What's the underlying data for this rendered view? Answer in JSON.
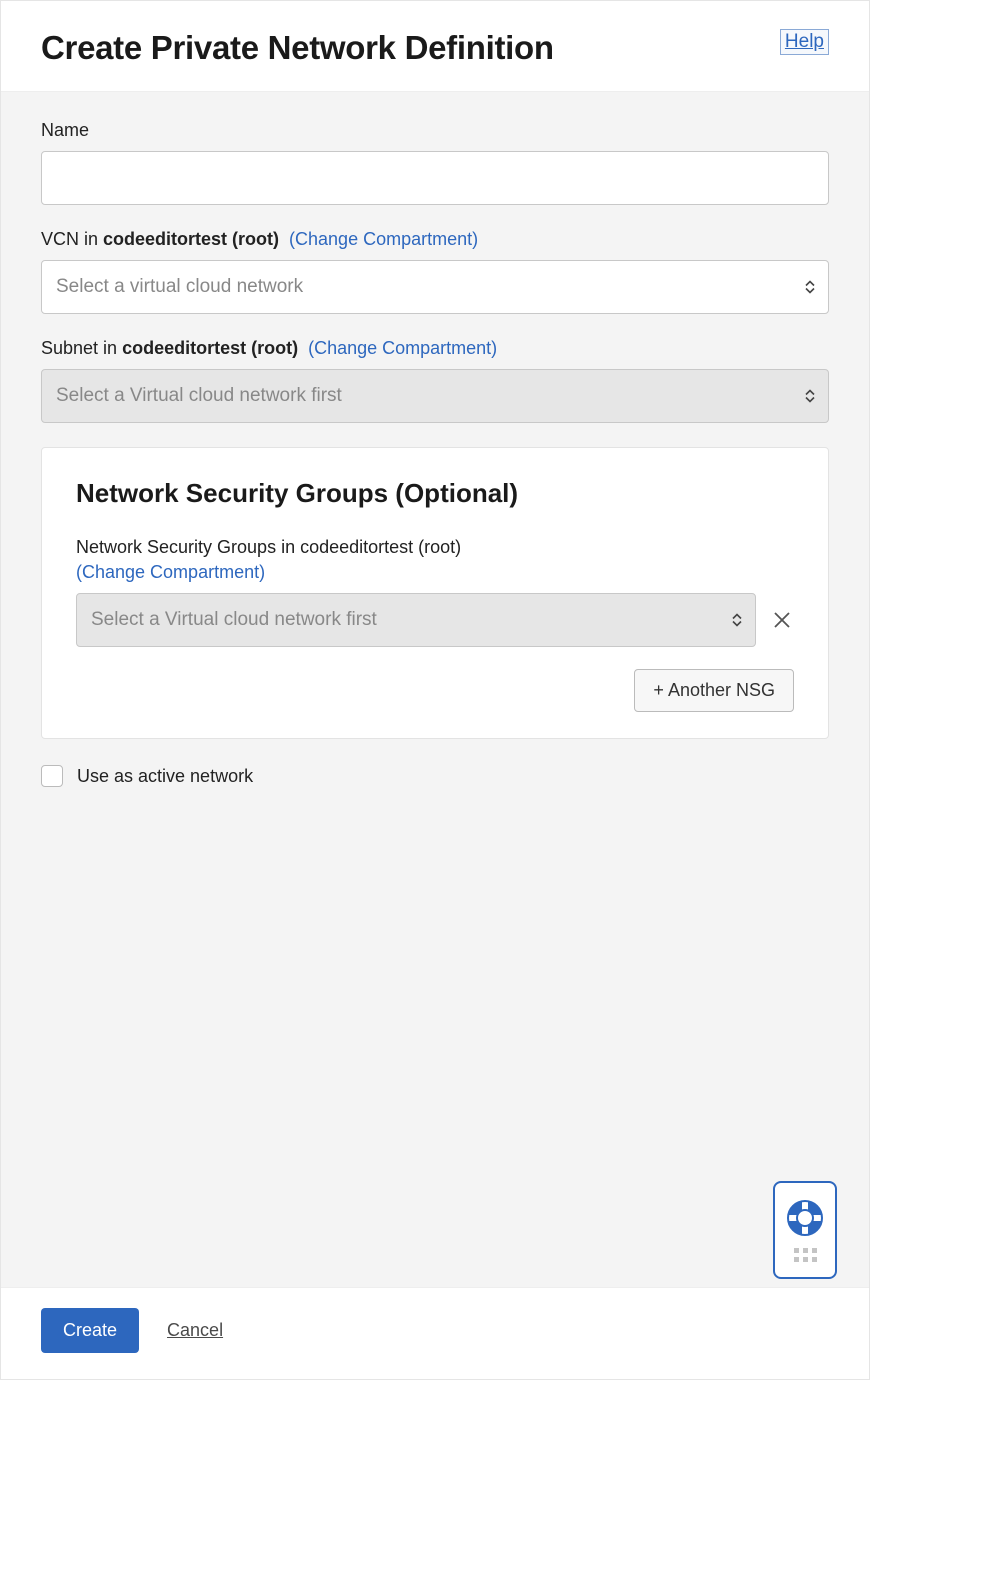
{
  "header": {
    "title": "Create Private Network Definition",
    "help": "Help"
  },
  "name_field": {
    "label": "Name",
    "value": ""
  },
  "vcn_field": {
    "label_prefix": "VCN in ",
    "compartment": "codeeditortest (root)",
    "change_text": "(Change Compartment)",
    "placeholder": "Select a virtual cloud network"
  },
  "subnet_field": {
    "label_prefix": "Subnet in ",
    "compartment": "codeeditortest (root)",
    "change_text": "(Change Compartment)",
    "placeholder": "Select a Virtual cloud network first"
  },
  "nsg": {
    "heading": "Network Security Groups (Optional)",
    "label_prefix": "Network Security Groups in ",
    "compartment": "codeeditortest (root)",
    "change_text": "(Change Compartment)",
    "placeholder": "Select a Virtual cloud network first",
    "add_button": "+ Another NSG"
  },
  "active_checkbox": {
    "label": "Use as active network",
    "checked": false
  },
  "footer": {
    "create": "Create",
    "cancel": "Cancel"
  }
}
